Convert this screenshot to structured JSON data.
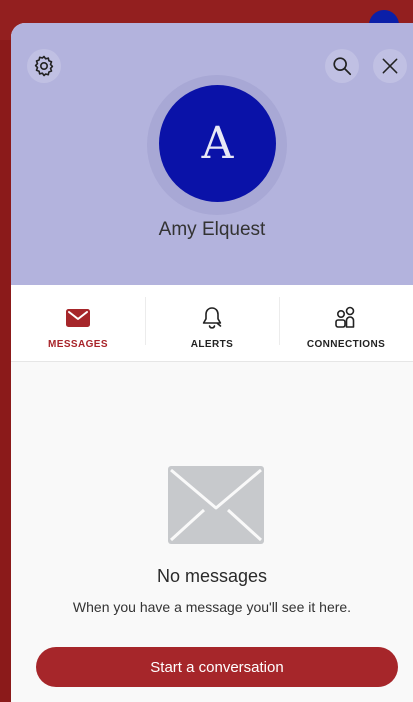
{
  "profile": {
    "initial": "A",
    "name": "Amy Elquest"
  },
  "tabs": [
    {
      "label": "MESSAGES",
      "icon": "envelope-icon",
      "active": true
    },
    {
      "label": "ALERTS",
      "icon": "bell-icon",
      "active": false
    },
    {
      "label": "CONNECTIONS",
      "icon": "people-icon",
      "active": false
    }
  ],
  "empty_state": {
    "title": "No messages",
    "subtitle": "When you have a message you'll see it here.",
    "icon": "envelope-icon"
  },
  "cta": {
    "label": "Start a conversation"
  },
  "colors": {
    "brand": "#a6262a",
    "header_bg": "#b3b3dd",
    "avatar_bg": "#0a12a8"
  },
  "header_icons": [
    "gear-icon",
    "search-icon",
    "close-icon"
  ]
}
